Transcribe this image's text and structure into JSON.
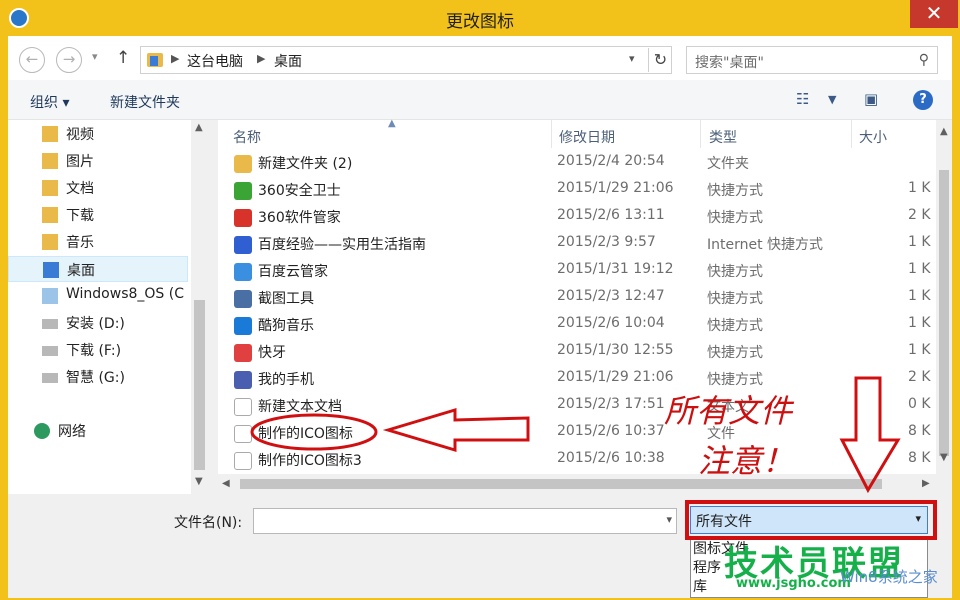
{
  "window": {
    "title": "更改图标",
    "close_glyph": "✕"
  },
  "nav": {
    "breadcrumb": [
      "这台电脑",
      "桌面"
    ],
    "search_placeholder": "搜索\"桌面\""
  },
  "toolbar": {
    "organize_label": "组织 ▾",
    "new_folder_label": "新建文件夹"
  },
  "sidebar": {
    "items": [
      {
        "label": "视频",
        "icon": "video-folder-icon"
      },
      {
        "label": "图片",
        "icon": "pictures-folder-icon"
      },
      {
        "label": "文档",
        "icon": "documents-folder-icon"
      },
      {
        "label": "下载",
        "icon": "downloads-folder-icon"
      },
      {
        "label": "音乐",
        "icon": "music-folder-icon"
      },
      {
        "label": "桌面",
        "icon": "desktop-folder-icon",
        "selected": true
      },
      {
        "label": "Windows8_OS (C",
        "icon": "os-drive-icon"
      },
      {
        "label": "安装 (D:)",
        "icon": "drive-icon"
      },
      {
        "label": "下载 (F:)",
        "icon": "drive-icon"
      },
      {
        "label": "智慧 (G:)",
        "icon": "drive-icon"
      },
      {
        "label": "网络",
        "icon": "network-icon"
      }
    ]
  },
  "columns": {
    "name": "名称",
    "date": "修改日期",
    "type": "类型",
    "size": "大小"
  },
  "files": [
    {
      "name": "新建文件夹 (2)",
      "date": "2015/2/4 20:54",
      "type": "文件夹",
      "size": "",
      "icon": "folder-icon",
      "color": "#e9b949"
    },
    {
      "name": "360安全卫士",
      "date": "2015/1/29 21:06",
      "type": "快捷方式",
      "size": "1 K",
      "icon": "360-security-icon",
      "color": "#3aa535"
    },
    {
      "name": "360软件管家",
      "date": "2015/2/6 13:11",
      "type": "快捷方式",
      "size": "2 K",
      "icon": "360-software-icon",
      "color": "#d8332a"
    },
    {
      "name": "百度经验——实用生活指南",
      "date": "2015/2/3 9:57",
      "type": "Internet 快捷方式",
      "size": "1 K",
      "icon": "baidu-icon",
      "color": "#2f5fd0"
    },
    {
      "name": "百度云管家",
      "date": "2015/1/31 19:12",
      "type": "快捷方式",
      "size": "1 K",
      "icon": "baidu-cloud-icon",
      "color": "#3b8fe0"
    },
    {
      "name": "截图工具",
      "date": "2015/2/3 12:47",
      "type": "快捷方式",
      "size": "1 K",
      "icon": "snipping-tool-icon",
      "color": "#4a6fa5"
    },
    {
      "name": "酷狗音乐",
      "date": "2015/2/6 10:04",
      "type": "快捷方式",
      "size": "1 K",
      "icon": "kugou-icon",
      "color": "#1a7ad8"
    },
    {
      "name": "快牙",
      "date": "2015/1/30 12:55",
      "type": "快捷方式",
      "size": "1 K",
      "icon": "kuaiya-icon",
      "color": "#e04040"
    },
    {
      "name": "我的手机",
      "date": "2015/1/29 21:06",
      "type": "快捷方式",
      "size": "2 K",
      "icon": "phone-icon",
      "color": "#4a5fb0"
    },
    {
      "name": "新建文本文档",
      "date": "2015/2/3 17:51",
      "type": "文本文",
      "size": "0 K",
      "icon": "text-document-icon",
      "color": "#ffffff"
    },
    {
      "name": "制作的ICO图标",
      "date": "2015/2/6 10:37",
      "type": "文件",
      "size": "8 K",
      "icon": "blank-file-icon",
      "color": "#ffffff"
    },
    {
      "name": "制作的ICO图标3",
      "date": "2015/2/6 10:38",
      "type": "",
      "size": "8 K",
      "icon": "blank-file-icon",
      "color": "#ffffff"
    }
  ],
  "bottom": {
    "filename_label": "文件名(N):",
    "filename_value": "",
    "filetype_value": "所有文件",
    "filetype_options": [
      "图标文件",
      "程序",
      "库"
    ]
  },
  "annotations": {
    "all_files": "所有文件",
    "attention": "注意！"
  },
  "watermark": {
    "brand": "技术员联盟",
    "url": "www.jsgho.com",
    "suffix": "Win8系统之家"
  }
}
